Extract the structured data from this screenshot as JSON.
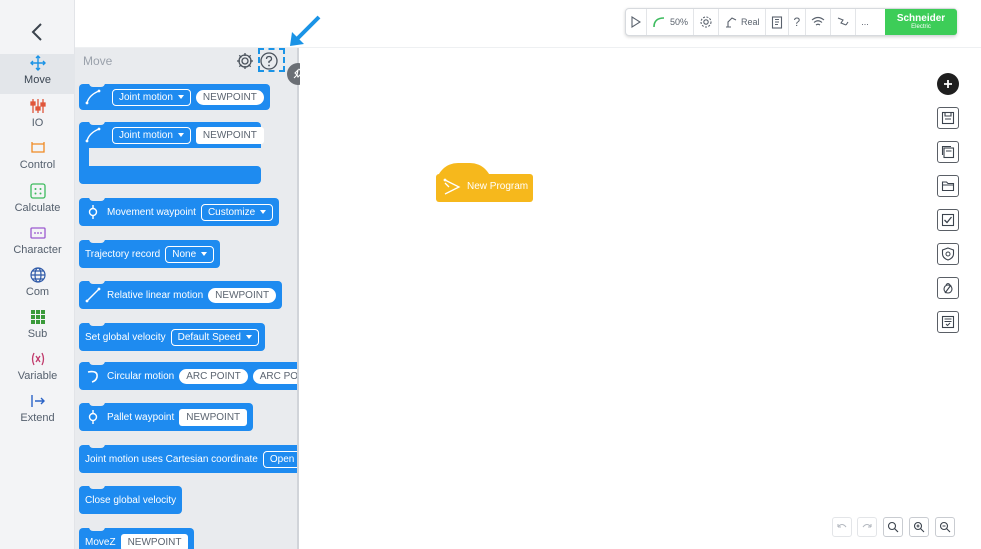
{
  "sidebar": {
    "categories": [
      {
        "label": "Move",
        "icon": "move-cross-icon",
        "active": true
      },
      {
        "label": "IO",
        "icon": "io-icon"
      },
      {
        "label": "Control",
        "icon": "control-icon"
      },
      {
        "label": "Calculate",
        "icon": "calculate-icon"
      },
      {
        "label": "Character",
        "icon": "character-icon"
      },
      {
        "label": "Com",
        "icon": "globe-icon"
      },
      {
        "label": "Sub",
        "icon": "grid-icon"
      },
      {
        "label": "Variable",
        "icon": "variable-icon"
      },
      {
        "label": "Extend",
        "icon": "extend-icon"
      }
    ]
  },
  "palette": {
    "title": "Move",
    "blocks": {
      "joint1": {
        "dropdown": "Joint motion",
        "point": "NEWPOINT"
      },
      "joint2": {
        "dropdown": "Joint motion",
        "point": "NEWPOINT"
      },
      "waypoint": {
        "label": "Movement waypoint",
        "dropdown": "Customize"
      },
      "trajectory": {
        "label": "Trajectory record",
        "dropdown": "None"
      },
      "relative": {
        "label": "Relative linear motion",
        "point": "NEWPOINT"
      },
      "velocity": {
        "label": "Set global velocity",
        "dropdown": "Default Speed"
      },
      "circular": {
        "label": "Circular motion",
        "point1": "ARC POINT",
        "point2": "ARC POIN"
      },
      "pallet": {
        "label": "Pallet waypoint",
        "point": "NEWPOINT"
      },
      "cartesian": {
        "label": "Joint motion uses Cartesian coordinate",
        "dropdown": "Open"
      },
      "close_velocity": {
        "label": "Close global velocity"
      },
      "movez": {
        "label": "MoveZ",
        "point": "NEWPOINT"
      }
    }
  },
  "canvas": {
    "program_block": "New Program"
  },
  "toolbar": {
    "speed": "50%",
    "mode": "Real",
    "help": "?",
    "more": "...",
    "brand_name": "Schneider",
    "brand_sub": "Electric"
  },
  "colors": {
    "block_blue": "#1e8bf0",
    "program_yellow": "#f6b81c",
    "brand_green": "#3dcd58",
    "highlight_blue": "#1a93e6"
  }
}
